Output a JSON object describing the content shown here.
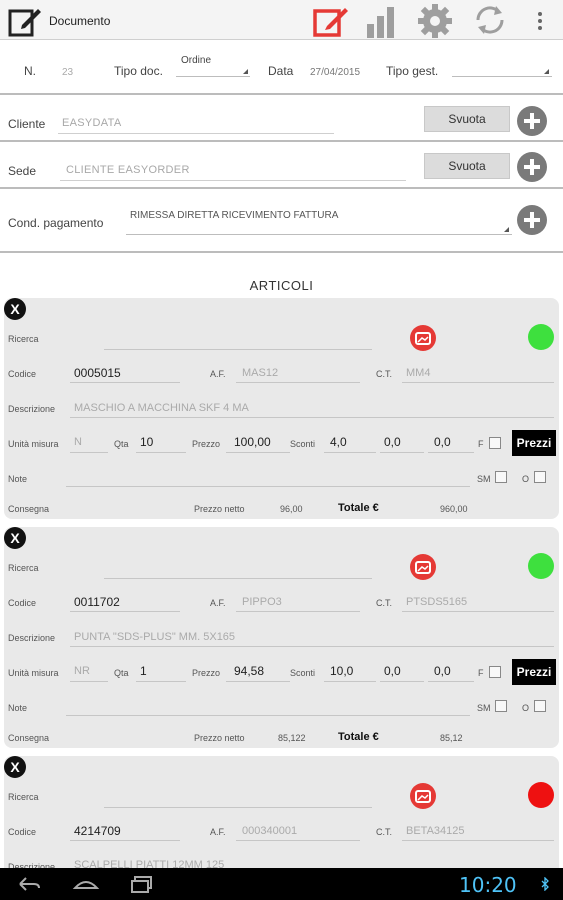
{
  "actionbar": {
    "title": "Documento",
    "icons": [
      "document-edit-icon",
      "edit-active-icon",
      "bar-chart-icon",
      "gear-icon",
      "sync-icon",
      "overflow-menu-icon"
    ],
    "active_color": "#e53935"
  },
  "header": {
    "n_label": "N.",
    "n_value": "23",
    "tipo_doc_label": "Tipo doc.",
    "tipo_doc_value": "Ordine",
    "data_label": "Data",
    "data_value": "27/04/2015",
    "tipo_gest_label": "Tipo gest.",
    "tipo_gest_value": ""
  },
  "cliente": {
    "label": "Cliente",
    "value": "EASYDATA",
    "button": "Svuota"
  },
  "sede": {
    "label": "Sede",
    "value": "CLIENTE EASYORDER",
    "button": "Svuota"
  },
  "pagamento": {
    "label": "Cond. pagamento",
    "value": "RIMESSA DIRETTA RICEVIMENTO FATTURA"
  },
  "articoli_title": "ARTICOLI",
  "labels": {
    "close": "X",
    "ricerca": "Ricerca",
    "codice": "Codice",
    "af": "A.F.",
    "ct": "C.T.",
    "descrizione": "Descrizione",
    "unita": "Unità misura",
    "qta": "Qta",
    "prezzo": "Prezzo",
    "sconti": "Sconti",
    "f": "F",
    "prezzi_btn": "Prezzi",
    "note": "Note",
    "sm": "SM",
    "o": "O",
    "consegna": "Consegna",
    "prezzo_netto": "Prezzo netto",
    "totale": "Totale €"
  },
  "articoli": [
    {
      "status_color": "#3ee03e",
      "codice": "0005015",
      "af": "MAS12",
      "ct": "MM4",
      "descrizione": "MASCHIO A MACCHINA SKF 4 MA",
      "unita": "N",
      "qta": "10",
      "prezzo": "100,00",
      "sconto1": "4,0",
      "sconto2": "0,0",
      "sconto3": "0,0",
      "prezzo_netto": "96,00",
      "totale": "960,00"
    },
    {
      "status_color": "#3ee03e",
      "codice": "0011702",
      "af": "PIPPO3",
      "ct": "PTSDS5165",
      "descrizione": "PUNTA \"SDS-PLUS\" MM. 5X165",
      "unita": "NR",
      "qta": "1",
      "prezzo": "94,58",
      "sconto1": "10,0",
      "sconto2": "0,0",
      "sconto3": "0,0",
      "prezzo_netto": "85,122",
      "totale": "85,12"
    },
    {
      "status_color": "#ee1111",
      "codice": "4214709",
      "af": "000340001",
      "ct": "BETA34125",
      "descrizione": "SCALPELLI PIATTI 12MM 125"
    }
  ],
  "statusbar": {
    "time": "10:20"
  }
}
